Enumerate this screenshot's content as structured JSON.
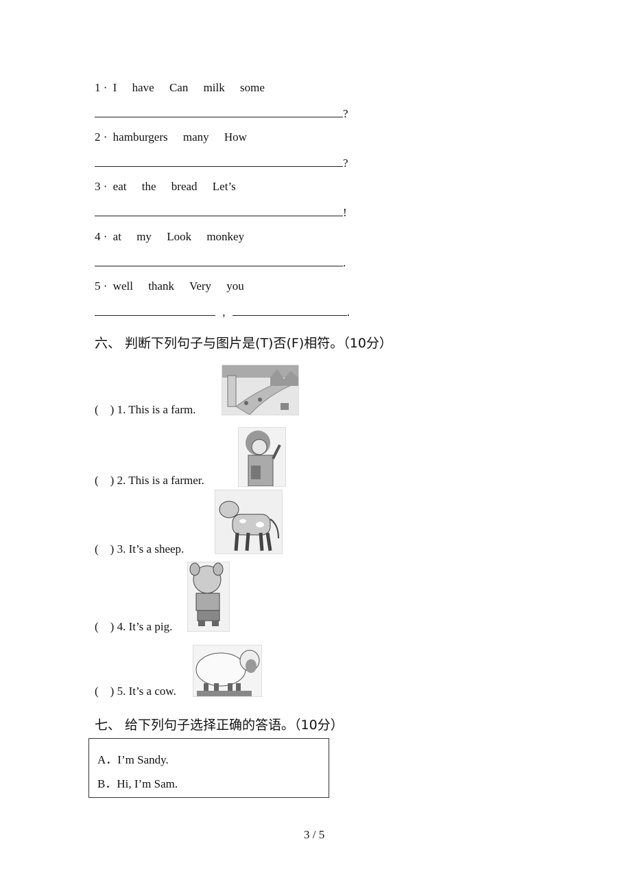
{
  "section5": {
    "items": [
      {
        "num": "1",
        "sep": "·",
        "words": [
          "I",
          "have",
          "Can",
          "milk",
          "some"
        ],
        "end": "?"
      },
      {
        "num": "2",
        "sep": "·",
        "words": [
          "hamburgers",
          "many",
          "How"
        ],
        "end": "?"
      },
      {
        "num": "3",
        "sep": "·",
        "words": [
          "eat",
          "the",
          "bread",
          "Let’s"
        ],
        "end": "!"
      },
      {
        "num": "4",
        "sep": "·",
        "words": [
          "at",
          "my",
          "Look",
          "monkey"
        ],
        "end": "."
      },
      {
        "num": "5",
        "sep": "·",
        "words": [
          "well",
          "thank",
          "Very",
          "you"
        ],
        "mid": ",",
        "end": "."
      }
    ]
  },
  "section6": {
    "heading": "六、  判断下列句子与图片是(T)否(F)相符。（10分）",
    "items": [
      {
        "paren": "(    )",
        "text": "1. This is a farm.",
        "image": "park-scene-image"
      },
      {
        "paren": "(    )",
        "text": "2. This is a farmer.",
        "image": "teacher-image"
      },
      {
        "paren": "(    )",
        "text": "3. It’s a sheep.",
        "image": "cow-image"
      },
      {
        "paren": "(    )",
        "text": "4. It’s a pig.",
        "image": "pig-image"
      },
      {
        "paren": "(    )",
        "text": "5. It’s a cow.",
        "image": "sheep-image"
      }
    ]
  },
  "section7": {
    "heading": "七、  给下列句子选择正确的答语。（10分）",
    "options": [
      {
        "label": "A．",
        "text": "I’m Sandy."
      },
      {
        "label": "B．",
        "text": "Hi, I’m Sam."
      }
    ]
  },
  "footer": {
    "page": "3 / 5"
  }
}
